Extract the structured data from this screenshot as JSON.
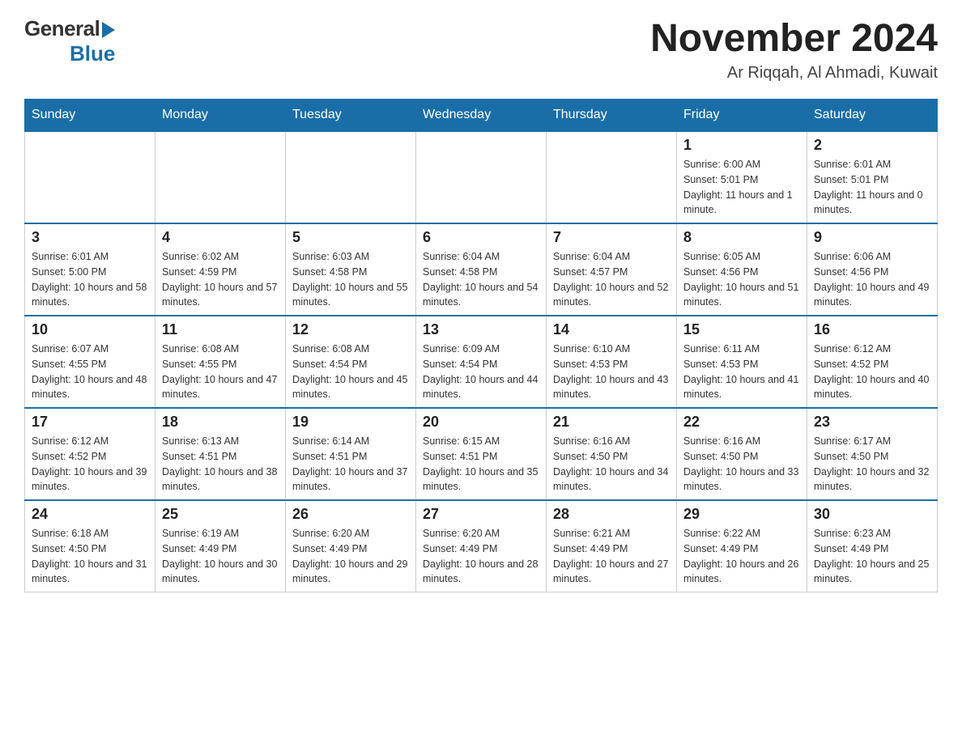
{
  "header": {
    "logo_general": "General",
    "logo_blue": "Blue",
    "month_title": "November 2024",
    "location": "Ar Riqqah, Al Ahmadi, Kuwait"
  },
  "days_of_week": [
    "Sunday",
    "Monday",
    "Tuesday",
    "Wednesday",
    "Thursday",
    "Friday",
    "Saturday"
  ],
  "weeks": [
    {
      "days": [
        {
          "number": "",
          "sunrise": "",
          "sunset": "",
          "daylight": ""
        },
        {
          "number": "",
          "sunrise": "",
          "sunset": "",
          "daylight": ""
        },
        {
          "number": "",
          "sunrise": "",
          "sunset": "",
          "daylight": ""
        },
        {
          "number": "",
          "sunrise": "",
          "sunset": "",
          "daylight": ""
        },
        {
          "number": "",
          "sunrise": "",
          "sunset": "",
          "daylight": ""
        },
        {
          "number": "1",
          "sunrise": "Sunrise: 6:00 AM",
          "sunset": "Sunset: 5:01 PM",
          "daylight": "Daylight: 11 hours and 1 minute."
        },
        {
          "number": "2",
          "sunrise": "Sunrise: 6:01 AM",
          "sunset": "Sunset: 5:01 PM",
          "daylight": "Daylight: 11 hours and 0 minutes."
        }
      ]
    },
    {
      "days": [
        {
          "number": "3",
          "sunrise": "Sunrise: 6:01 AM",
          "sunset": "Sunset: 5:00 PM",
          "daylight": "Daylight: 10 hours and 58 minutes."
        },
        {
          "number": "4",
          "sunrise": "Sunrise: 6:02 AM",
          "sunset": "Sunset: 4:59 PM",
          "daylight": "Daylight: 10 hours and 57 minutes."
        },
        {
          "number": "5",
          "sunrise": "Sunrise: 6:03 AM",
          "sunset": "Sunset: 4:58 PM",
          "daylight": "Daylight: 10 hours and 55 minutes."
        },
        {
          "number": "6",
          "sunrise": "Sunrise: 6:04 AM",
          "sunset": "Sunset: 4:58 PM",
          "daylight": "Daylight: 10 hours and 54 minutes."
        },
        {
          "number": "7",
          "sunrise": "Sunrise: 6:04 AM",
          "sunset": "Sunset: 4:57 PM",
          "daylight": "Daylight: 10 hours and 52 minutes."
        },
        {
          "number": "8",
          "sunrise": "Sunrise: 6:05 AM",
          "sunset": "Sunset: 4:56 PM",
          "daylight": "Daylight: 10 hours and 51 minutes."
        },
        {
          "number": "9",
          "sunrise": "Sunrise: 6:06 AM",
          "sunset": "Sunset: 4:56 PM",
          "daylight": "Daylight: 10 hours and 49 minutes."
        }
      ]
    },
    {
      "days": [
        {
          "number": "10",
          "sunrise": "Sunrise: 6:07 AM",
          "sunset": "Sunset: 4:55 PM",
          "daylight": "Daylight: 10 hours and 48 minutes."
        },
        {
          "number": "11",
          "sunrise": "Sunrise: 6:08 AM",
          "sunset": "Sunset: 4:55 PM",
          "daylight": "Daylight: 10 hours and 47 minutes."
        },
        {
          "number": "12",
          "sunrise": "Sunrise: 6:08 AM",
          "sunset": "Sunset: 4:54 PM",
          "daylight": "Daylight: 10 hours and 45 minutes."
        },
        {
          "number": "13",
          "sunrise": "Sunrise: 6:09 AM",
          "sunset": "Sunset: 4:54 PM",
          "daylight": "Daylight: 10 hours and 44 minutes."
        },
        {
          "number": "14",
          "sunrise": "Sunrise: 6:10 AM",
          "sunset": "Sunset: 4:53 PM",
          "daylight": "Daylight: 10 hours and 43 minutes."
        },
        {
          "number": "15",
          "sunrise": "Sunrise: 6:11 AM",
          "sunset": "Sunset: 4:53 PM",
          "daylight": "Daylight: 10 hours and 41 minutes."
        },
        {
          "number": "16",
          "sunrise": "Sunrise: 6:12 AM",
          "sunset": "Sunset: 4:52 PM",
          "daylight": "Daylight: 10 hours and 40 minutes."
        }
      ]
    },
    {
      "days": [
        {
          "number": "17",
          "sunrise": "Sunrise: 6:12 AM",
          "sunset": "Sunset: 4:52 PM",
          "daylight": "Daylight: 10 hours and 39 minutes."
        },
        {
          "number": "18",
          "sunrise": "Sunrise: 6:13 AM",
          "sunset": "Sunset: 4:51 PM",
          "daylight": "Daylight: 10 hours and 38 minutes."
        },
        {
          "number": "19",
          "sunrise": "Sunrise: 6:14 AM",
          "sunset": "Sunset: 4:51 PM",
          "daylight": "Daylight: 10 hours and 37 minutes."
        },
        {
          "number": "20",
          "sunrise": "Sunrise: 6:15 AM",
          "sunset": "Sunset: 4:51 PM",
          "daylight": "Daylight: 10 hours and 35 minutes."
        },
        {
          "number": "21",
          "sunrise": "Sunrise: 6:16 AM",
          "sunset": "Sunset: 4:50 PM",
          "daylight": "Daylight: 10 hours and 34 minutes."
        },
        {
          "number": "22",
          "sunrise": "Sunrise: 6:16 AM",
          "sunset": "Sunset: 4:50 PM",
          "daylight": "Daylight: 10 hours and 33 minutes."
        },
        {
          "number": "23",
          "sunrise": "Sunrise: 6:17 AM",
          "sunset": "Sunset: 4:50 PM",
          "daylight": "Daylight: 10 hours and 32 minutes."
        }
      ]
    },
    {
      "days": [
        {
          "number": "24",
          "sunrise": "Sunrise: 6:18 AM",
          "sunset": "Sunset: 4:50 PM",
          "daylight": "Daylight: 10 hours and 31 minutes."
        },
        {
          "number": "25",
          "sunrise": "Sunrise: 6:19 AM",
          "sunset": "Sunset: 4:49 PM",
          "daylight": "Daylight: 10 hours and 30 minutes."
        },
        {
          "number": "26",
          "sunrise": "Sunrise: 6:20 AM",
          "sunset": "Sunset: 4:49 PM",
          "daylight": "Daylight: 10 hours and 29 minutes."
        },
        {
          "number": "27",
          "sunrise": "Sunrise: 6:20 AM",
          "sunset": "Sunset: 4:49 PM",
          "daylight": "Daylight: 10 hours and 28 minutes."
        },
        {
          "number": "28",
          "sunrise": "Sunrise: 6:21 AM",
          "sunset": "Sunset: 4:49 PM",
          "daylight": "Daylight: 10 hours and 27 minutes."
        },
        {
          "number": "29",
          "sunrise": "Sunrise: 6:22 AM",
          "sunset": "Sunset: 4:49 PM",
          "daylight": "Daylight: 10 hours and 26 minutes."
        },
        {
          "number": "30",
          "sunrise": "Sunrise: 6:23 AM",
          "sunset": "Sunset: 4:49 PM",
          "daylight": "Daylight: 10 hours and 25 minutes."
        }
      ]
    }
  ]
}
